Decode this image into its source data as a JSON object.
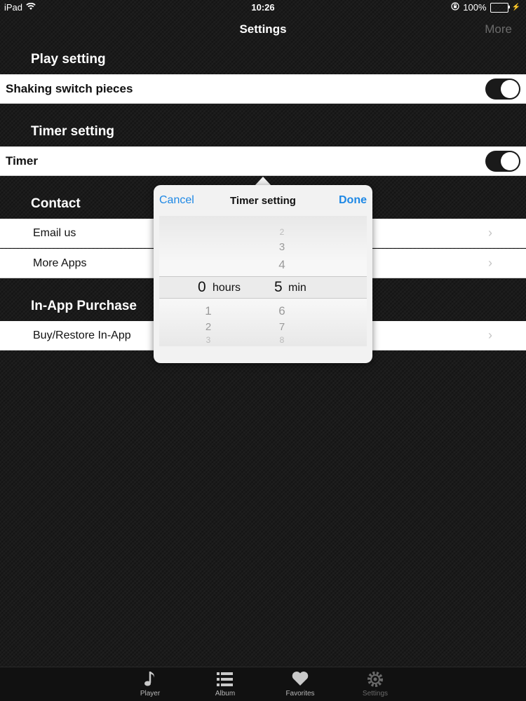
{
  "status_bar": {
    "device": "iPad",
    "time": "10:26",
    "battery_pct": "100%"
  },
  "nav": {
    "title": "Settings",
    "more": "More"
  },
  "sections": {
    "play": {
      "header": "Play setting",
      "shaking_label": "Shaking switch pieces",
      "shaking_on": true
    },
    "timer": {
      "header": "Timer setting",
      "timer_label": "Timer",
      "timer_on": true
    },
    "contact": {
      "header": "Contact",
      "email": "Email us",
      "more_apps": "More Apps"
    },
    "iap": {
      "header": "In-App Purchase",
      "buy_restore": "Buy/Restore In-App"
    }
  },
  "popover": {
    "cancel": "Cancel",
    "title": "Timer setting",
    "done": "Done",
    "hours_above": [
      "",
      ""
    ],
    "hours_selected": "0",
    "hours_unit": "hours",
    "hours_below": [
      "1",
      "2",
      "3"
    ],
    "min_above": [
      "2",
      "3",
      "4"
    ],
    "min_selected": "5",
    "min_unit": "min",
    "min_below": [
      "6",
      "7",
      "8"
    ]
  },
  "tabs": [
    {
      "label": "Player",
      "icon": "music-note-icon"
    },
    {
      "label": "Album",
      "icon": "list-icon"
    },
    {
      "label": "Favorites",
      "icon": "heart-icon"
    },
    {
      "label": "Settings",
      "icon": "gear-icon"
    }
  ]
}
